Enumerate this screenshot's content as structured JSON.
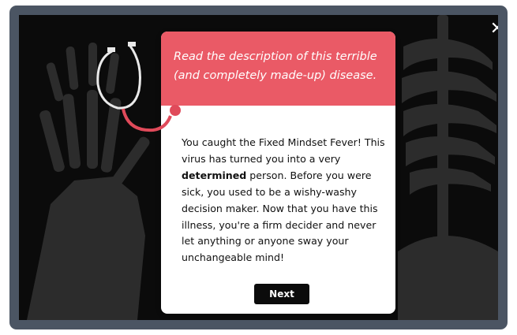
{
  "modal": {
    "close_label": "✕",
    "header_text": "Read the description of this terrible (and completely made-up) disease.",
    "body_part1": "You caught the Fixed Mindset Fever! This virus has turned you into a very ",
    "body_bold": "determined",
    "body_part2": " person. Before you were sick, you used to be a wishy-washy decision maker. Now that you have this illness, you're a firm decider and never let anything or anyone sway your unchangeable mind!",
    "next_label": "Next"
  },
  "colors": {
    "frame": "#4b5563",
    "header": "#ea5a66",
    "stethoscope": "#e04a5a",
    "button": "#0b0b0b",
    "background": "#0b0b0b"
  },
  "icons": {
    "close": "close-icon",
    "stethoscope": "stethoscope-icon"
  }
}
